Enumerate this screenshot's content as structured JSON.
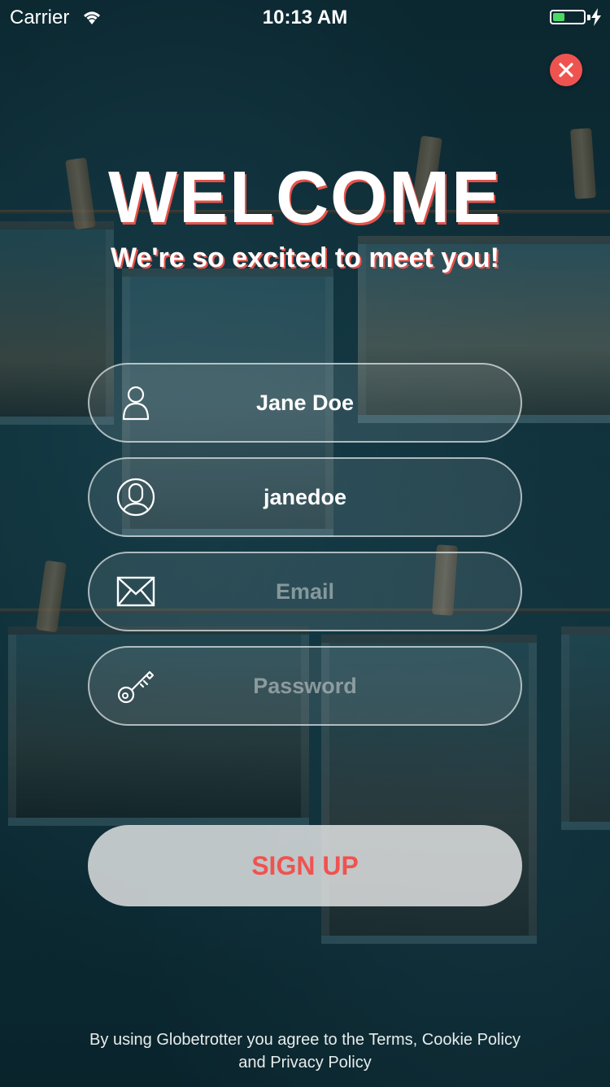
{
  "status_bar": {
    "carrier": "Carrier",
    "time": "10:13 AM"
  },
  "header": {
    "title": "WELCOME",
    "subtitle": "We're so excited to meet you!"
  },
  "form": {
    "full_name": {
      "value": "Jane Doe",
      "icon": "user-icon"
    },
    "username": {
      "value": "janedoe",
      "icon": "user-avatar-icon"
    },
    "email": {
      "value": "",
      "placeholder": "Email",
      "icon": "envelope-icon"
    },
    "password": {
      "value": "",
      "placeholder": "Password",
      "icon": "key-icon"
    }
  },
  "actions": {
    "signup_label": "SIGN UP"
  },
  "footer": {
    "legal_text": "By using Globetrotter you agree to the Terms, Cookie Policy and Privacy Policy"
  },
  "colors": {
    "accent": "#ef5350",
    "background": "#0f313a"
  }
}
